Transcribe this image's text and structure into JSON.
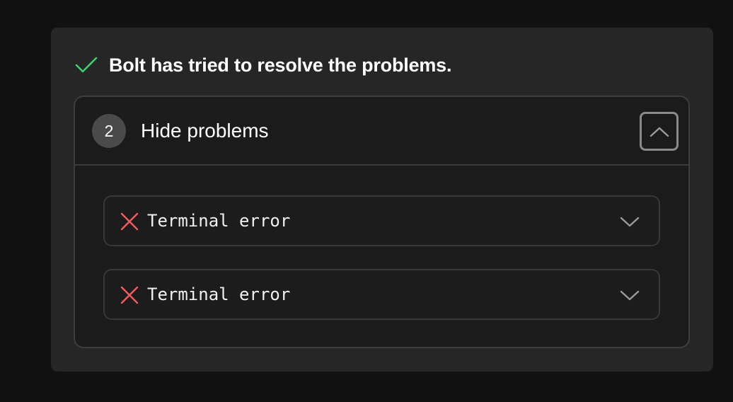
{
  "status": {
    "message": "Bolt has tried to resolve the problems.",
    "icon": "check-icon",
    "icon_color": "#3ecf6e"
  },
  "problems": {
    "count": "2",
    "toggle_label": "Hide problems",
    "toggle_icon": "chevron-up-icon",
    "items": [
      {
        "label": "Terminal error",
        "icon": "x-icon",
        "icon_color": "#ef5b5b",
        "expand_icon": "chevron-down-icon"
      },
      {
        "label": "Terminal error",
        "icon": "x-icon",
        "icon_color": "#ef5b5b",
        "expand_icon": "chevron-down-icon"
      }
    ]
  }
}
